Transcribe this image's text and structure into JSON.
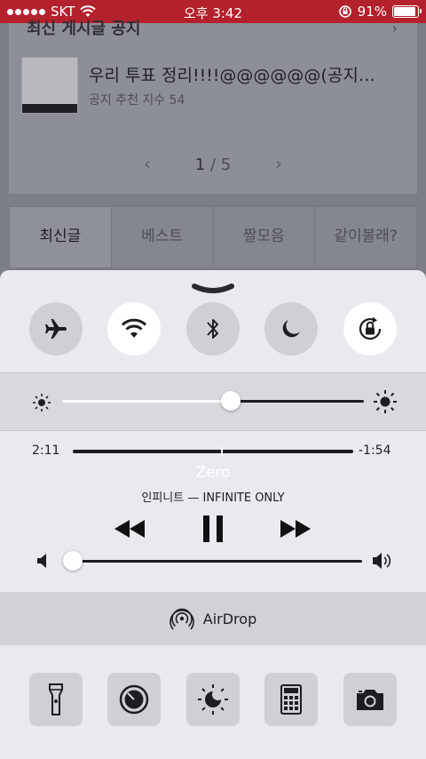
{
  "status_bar": {
    "carrier": "SKT",
    "time": "오후 3:42",
    "battery_percent_text": "91%",
    "battery_level": 0.91
  },
  "background_app": {
    "section_title": "최신 게시글 공지",
    "section_arrow": "›",
    "post": {
      "title": "우리 투표 정리!!!!@@@@@@(공지…",
      "subtitle": "공지 추천 지수 54"
    },
    "pager": {
      "prev": "‹",
      "current": "1",
      "separator": "/",
      "total": "5",
      "next": "›"
    },
    "tabs": [
      {
        "label": "최신글",
        "active": true
      },
      {
        "label": "베스트",
        "active": false
      },
      {
        "label": "짤모음",
        "active": false
      },
      {
        "label": "같이볼래?",
        "active": false
      }
    ]
  },
  "control_center": {
    "toggles": [
      {
        "icon": "airplane-icon",
        "on": false
      },
      {
        "icon": "wifi-icon",
        "on": true
      },
      {
        "icon": "bluetooth-icon",
        "on": false
      },
      {
        "icon": "moon-icon",
        "on": false
      },
      {
        "icon": "rotation-lock-icon",
        "on": true
      }
    ],
    "brightness_level": 0.56,
    "music": {
      "elapsed": "2:11",
      "remaining": "-1:54",
      "progress": 0.53,
      "song": "Zero",
      "artist_album": "인피니트 — INFINITE ONLY",
      "volume_level": 0.0
    },
    "airdrop_label": "AirDrop",
    "shortcuts": [
      "flashlight-icon",
      "timer-icon",
      "night-shift-icon",
      "calculator-icon",
      "camera-icon"
    ],
    "colors": {
      "status_bar": "#b3212d",
      "panel": "#e9eaee",
      "toggle_on": "#ffffff",
      "toggle_off": "#cfd0d4"
    }
  }
}
